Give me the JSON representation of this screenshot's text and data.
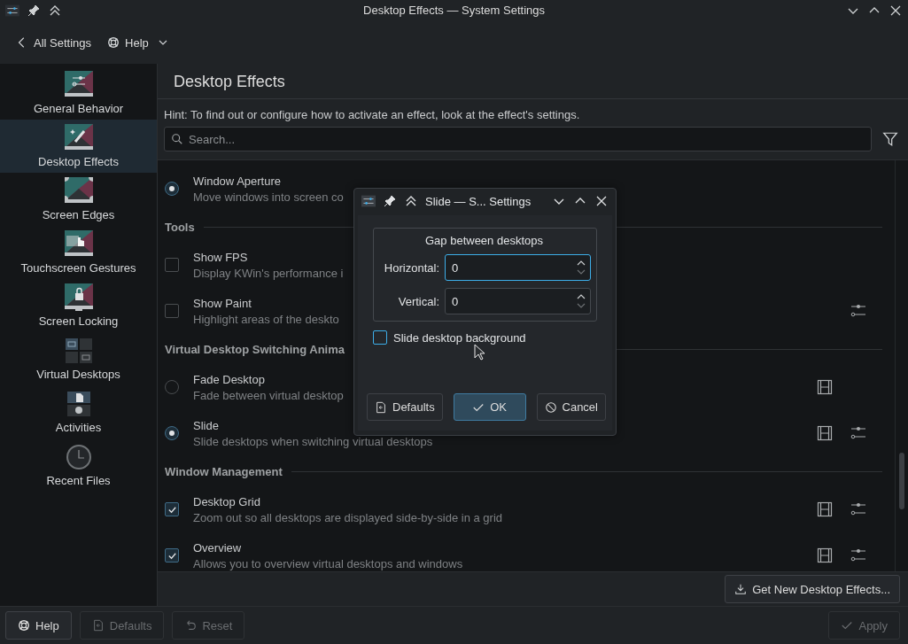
{
  "window": {
    "title": "Desktop Effects — System Settings"
  },
  "toolbar": {
    "back": "All Settings",
    "help": "Help"
  },
  "sidebar": {
    "items": [
      {
        "label": "General Behavior",
        "selected": false
      },
      {
        "label": "Desktop Effects",
        "selected": true
      },
      {
        "label": "Screen Edges",
        "selected": false
      },
      {
        "label": "Touchscreen Gestures",
        "selected": false
      },
      {
        "label": "Screen Locking",
        "selected": false
      },
      {
        "label": "Virtual Desktops",
        "selected": false
      },
      {
        "label": "Activities",
        "selected": false
      },
      {
        "label": "Recent Files",
        "selected": false
      }
    ]
  },
  "page": {
    "title": "Desktop Effects",
    "hint": "Hint: To find out or configure how to activate an effect, look at the effect's settings.",
    "search": {
      "placeholder": "Search..."
    }
  },
  "sections": [
    {
      "items": [
        {
          "kind": "radio",
          "checked": true,
          "name": "Window Aperture",
          "description": "Move windows into screen co",
          "video": false,
          "configure": false
        }
      ]
    },
    {
      "title": "Tools",
      "items": [
        {
          "kind": "checkbox",
          "checked": false,
          "name": "Show FPS",
          "description": "Display KWin's performance i",
          "video": false,
          "configure": false
        },
        {
          "kind": "checkbox",
          "checked": false,
          "name": "Show Paint",
          "description": "Highlight areas of the deskto",
          "video": false,
          "configure": true
        }
      ]
    },
    {
      "title": "Virtual Desktop Switching Anima",
      "items": [
        {
          "kind": "radio",
          "checked": false,
          "name": "Fade Desktop",
          "description": "Fade between virtual desktop",
          "video": true,
          "configure": false
        },
        {
          "kind": "radio",
          "checked": true,
          "name": "Slide",
          "description": "Slide desktops when switching virtual desktops",
          "video": true,
          "configure": true
        }
      ]
    },
    {
      "title": "Window Management",
      "items": [
        {
          "kind": "checkbox",
          "checked": true,
          "name": "Desktop Grid",
          "description": "Zoom out so all desktops are displayed side-by-side in a grid",
          "video": true,
          "configure": true
        },
        {
          "kind": "checkbox",
          "checked": true,
          "name": "Overview",
          "description": "Allows you to overview virtual desktops and windows",
          "video": true,
          "configure": true
        }
      ]
    }
  ],
  "get_new": "Get New Desktop Effects...",
  "footer": {
    "left": [
      {
        "kind": "help",
        "label": "Help",
        "disabled": false
      },
      {
        "kind": "defaults",
        "label": "Defaults",
        "disabled": true
      },
      {
        "kind": "reset",
        "label": "Reset",
        "disabled": true
      }
    ],
    "right": [
      {
        "kind": "apply",
        "label": "Apply",
        "disabled": true
      }
    ]
  },
  "dialog": {
    "title": "Slide — S... Settings",
    "group": "Gap between desktops",
    "fields": [
      {
        "label": "Horizontal:",
        "value": "0",
        "focused": true
      },
      {
        "label": "Vertical:",
        "value": "0",
        "focused": false
      }
    ],
    "checkbox": {
      "label": "Slide desktop background",
      "checked": false
    },
    "buttons": [
      {
        "kind": "defaults",
        "label": "Defaults",
        "default": false
      },
      {
        "kind": "ok",
        "label": "OK",
        "default": true
      },
      {
        "kind": "cancel",
        "label": "Cancel",
        "default": false
      }
    ]
  }
}
